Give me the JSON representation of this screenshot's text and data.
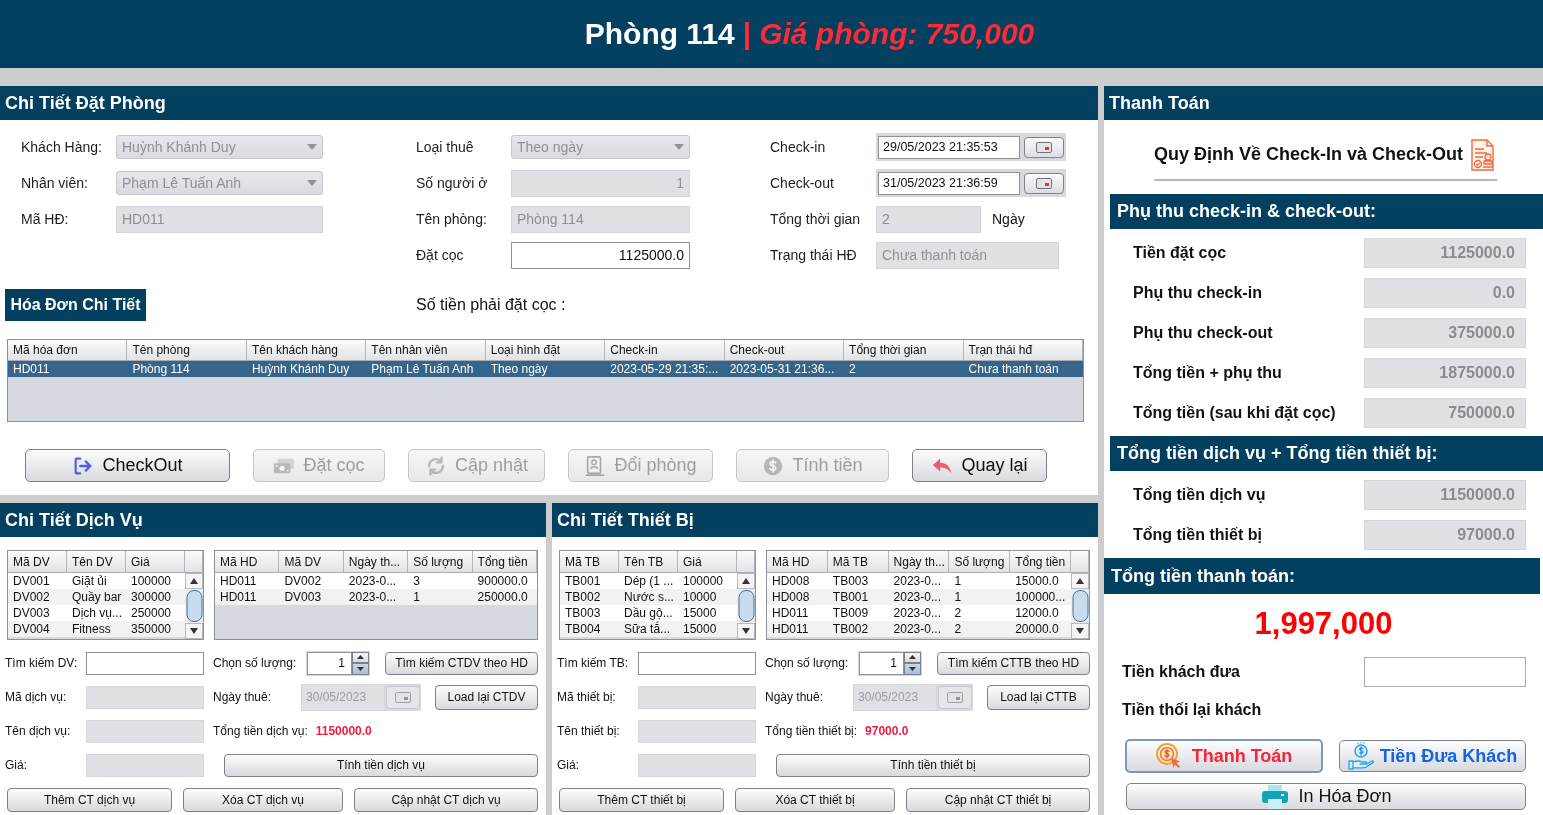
{
  "header": {
    "room": "Phòng 114",
    "separator": "|",
    "price": "Giá phòng: 750,000"
  },
  "booking": {
    "title": "Chi Tiết Đặt Phòng",
    "field_groups": [
      {
        "fields": [
          {
            "kind": "combo",
            "label": "Khách Hàng:",
            "value": "Huỳnh Khánh Duy",
            "disabled": true
          },
          {
            "kind": "combo",
            "label": "Nhân viên:",
            "value": "Phạm Lê Tuấn Anh",
            "disabled": true
          },
          {
            "kind": "text",
            "label": "Mã HĐ:",
            "value": "HD011",
            "disabled": true
          }
        ]
      },
      {
        "fields": [
          {
            "kind": "combo",
            "label": "Loại thuê",
            "value": "Theo ngày",
            "disabled": true
          },
          {
            "kind": "number",
            "label": "Số người ở",
            "value": "1",
            "disabled": true
          },
          {
            "kind": "text",
            "label": "Tên phòng:",
            "value": "Phòng 114",
            "disabled": true
          },
          {
            "kind": "number",
            "label": "Đặt cọc",
            "value": "1125000.0",
            "disabled": false
          }
        ]
      },
      {
        "fields": [
          {
            "kind": "date",
            "label": "Check-in",
            "value": "29/05/2023 21:35:53",
            "disabled": false
          },
          {
            "kind": "date",
            "label": "Check-out",
            "value": "31/05/2023 21:36:59",
            "disabled": false
          },
          {
            "kind": "text",
            "label": "Tổng thời gian",
            "value": "2",
            "unit": "Ngày",
            "disabled": true
          },
          {
            "kind": "text",
            "label": "Trạng thái HĐ",
            "value": "Chưa thanh toán",
            "disabled": true
          }
        ]
      }
    ],
    "invoice_badge": "Hóa Đơn Chi Tiết",
    "deposit_note": "Số tiền phải đặt cọc :",
    "invoice_table": {
      "columns": [
        "Mã hóa đơn",
        "Tên phòng",
        "Tên khách hàng",
        "Tên nhân viên",
        "Loại hình đặt",
        "Check-in",
        "Check-out",
        "Tổng thời gian",
        "Trạn thái hđ"
      ],
      "rows": [
        {
          "selected": true,
          "cells": [
            "HD011",
            "Phòng 114",
            "Huỳnh Khánh Duy",
            "Phạm Lê Tuấn Anh",
            "Theo ngày",
            "2023-05-29 21:35:...",
            "2023-05-31 21:36...",
            "2",
            "Chưa thanh toán"
          ]
        }
      ]
    },
    "actions": [
      {
        "label": "CheckOut",
        "disabled": false
      },
      {
        "label": "Đặt cọc",
        "disabled": true
      },
      {
        "label": "Cập nhật",
        "disabled": true
      },
      {
        "label": "Đổi phòng",
        "disabled": true
      },
      {
        "label": "Tính tiền",
        "disabled": true
      },
      {
        "label": "Quay lại",
        "disabled": false
      }
    ]
  },
  "services": {
    "title": "Chi Tiết Dịch Vụ",
    "catalog_table": {
      "columns": [
        "Mã DV",
        "Tên DV",
        "Giá"
      ],
      "rows": [
        {
          "selected": false,
          "cells": [
            "DV001",
            "Giặt ủi",
            "100000"
          ]
        },
        {
          "selected": false,
          "cells": [
            "DV002",
            "Quầy bar",
            "300000"
          ]
        },
        {
          "selected": false,
          "cells": [
            "DV003",
            "Dịch vụ...",
            "250000"
          ]
        },
        {
          "selected": false,
          "cells": [
            "DV004",
            "Fitness",
            "350000"
          ]
        }
      ]
    },
    "detail_table": {
      "columns": [
        "Mã HD",
        "Mã DV",
        "Ngày th...",
        "Số lượng",
        "Tổng tiền"
      ],
      "rows": [
        {
          "selected": false,
          "cells": [
            "HD011",
            "DV002",
            "2023-0...",
            "3",
            "900000.0"
          ]
        },
        {
          "selected": false,
          "cells": [
            "HD011",
            "DV003",
            "2023-0...",
            "1",
            "250000.0"
          ]
        }
      ]
    },
    "search_label": "Tìm kiếm DV:",
    "fields": [
      {
        "label": "Mã dịch vụ:",
        "disabled": true
      },
      {
        "label": "Tên dịch vụ:",
        "disabled": true
      },
      {
        "label": "Giá:",
        "disabled": true
      }
    ],
    "quantity": {
      "label": "Chọn số lượng:",
      "value": "1"
    },
    "search_button": "Tìm kiếm CTDV theo HD",
    "date": {
      "label": "Ngày thuê:",
      "value": "30/05/2023",
      "disabled": true
    },
    "reload_button": "Load lại CTDV",
    "total": {
      "label": "Tổng tiền dịch vụ:",
      "value": "1150000.0"
    },
    "calc_button": "Tính tiền dịch vụ",
    "buttons": [
      "Thêm CT dịch vụ",
      "Xóa CT dịch vụ",
      "Cập nhật CT dịch vụ"
    ]
  },
  "equipment": {
    "title": "Chi Tiết Thiết Bị",
    "catalog_table": {
      "columns": [
        "Mã TB",
        "Tên TB",
        "Giá"
      ],
      "rows": [
        {
          "selected": false,
          "cells": [
            "TB001",
            "Dép (1 ...",
            "100000"
          ]
        },
        {
          "selected": false,
          "cells": [
            "TB002",
            "Nước s...",
            "10000"
          ]
        },
        {
          "selected": false,
          "cells": [
            "TB003",
            "Dầu gộ...",
            "15000"
          ]
        },
        {
          "selected": false,
          "cells": [
            "TB004",
            "Sữa tắ...",
            "15000"
          ]
        }
      ]
    },
    "detail_table": {
      "columns": [
        "Mã HD",
        "Mã TB",
        "Ngày th...",
        "Số lượng",
        "Tổng tiền"
      ],
      "rows": [
        {
          "selected": false,
          "cells": [
            "HD008",
            "TB003",
            "2023-0...",
            "1",
            "15000.0"
          ]
        },
        {
          "selected": false,
          "cells": [
            "HD008",
            "TB001",
            "2023-0...",
            "1",
            "100000..."
          ]
        },
        {
          "selected": false,
          "cells": [
            "HD011",
            "TB009",
            "2023-0...",
            "2",
            "12000.0"
          ]
        },
        {
          "selected": false,
          "cells": [
            "HD011",
            "TB002",
            "2023-0...",
            "2",
            "20000.0"
          ]
        }
      ]
    },
    "search_label": "Tìm kiếm TB:",
    "fields": [
      {
        "label": "Mã thiết bị:",
        "disabled": true
      },
      {
        "label": "Tên thiết bị:",
        "disabled": true
      },
      {
        "label": "Giá:",
        "disabled": true
      }
    ],
    "quantity": {
      "label": "Chọn số lượng:",
      "value": "1"
    },
    "search_button": "Tìm kiếm CTTB theo HD",
    "date": {
      "label": "Ngày thuê:",
      "value": "30/05/2023",
      "disabled": true
    },
    "reload_button": "Load lại CTTB",
    "total": {
      "label": "Tổng tiền thiết bị:",
      "value": "97000.0"
    },
    "calc_button": "Tính tiền thiết bị",
    "buttons": [
      "Thêm CT thiết bị",
      "Xóa CT thiết bị",
      "Cập nhật CT thiết bị"
    ]
  },
  "payment": {
    "title": "Thanh Toán",
    "rules_link": "Quy Định Về Check-In và Check-Out",
    "sections": [
      {
        "title": "Phụ thu check-in & check-out:",
        "rows": [
          {
            "label": "Tiền đặt cọc",
            "value": "1125000.0"
          },
          {
            "label": "Phụ thu check-in",
            "value": "0.0"
          },
          {
            "label": "Phụ thu check-out",
            "value": "375000.0"
          },
          {
            "label": "Tổng tiền + phụ thu",
            "value": "1875000.0"
          },
          {
            "label": "Tổng tiền (sau khi đặt cọc)",
            "value": "750000.0"
          }
        ]
      },
      {
        "title": "Tổng tiền dịch vụ + Tổng tiền thiết bị:",
        "rows": [
          {
            "label": "Tổng tiền dịch vụ",
            "value": "1150000.0"
          },
          {
            "label": "Tổng tiền thiết bị",
            "value": "97000.0"
          }
        ]
      }
    ],
    "total": {
      "title": "Tổng tiền thanh toán:",
      "amount": "1,997,000",
      "cash_label": "Tiền khách đưa",
      "change_label": "Tiền thối lại khách"
    },
    "buttons": [
      {
        "label": "Thanh Toán",
        "focused": true
      },
      {
        "label": "Tiền Đưa Khách",
        "focused": false
      },
      {
        "label": "In Hóa Đơn",
        "focused": false
      }
    ]
  }
}
